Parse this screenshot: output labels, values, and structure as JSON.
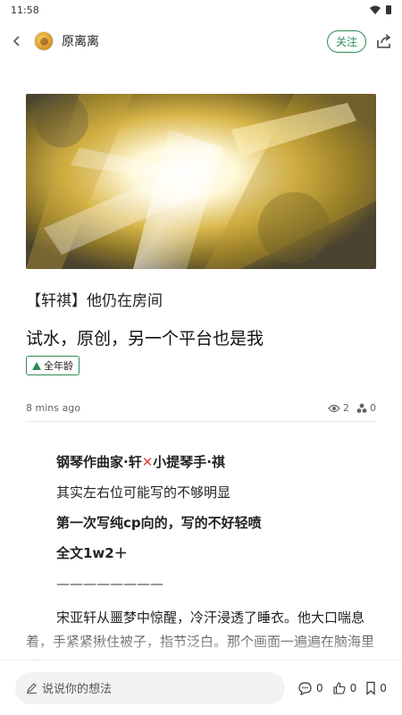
{
  "status": {
    "time": "11:58"
  },
  "header": {
    "author": "原离离",
    "follow_label": "关注"
  },
  "work": {
    "title": "【轩祺】他仍在房间",
    "summary": "试水，原创，另一个平台也是我",
    "rating": "全年龄",
    "time_ago": "8 mins ago",
    "views": "2",
    "kudos": "0"
  },
  "body": {
    "line1_a": "钢琴作曲家·轩",
    "line1_b": "小提琴手·祺",
    "line2": "其实左右位可能写的不够明显",
    "line3": "第一次写纯cp向的，写的不好轻喷",
    "line4": "全文1w2＋",
    "divider": "————————",
    "story": "宋亚轩从噩梦中惊醒，冷汗浸透了睡衣。他大口喘息着，手紧紧揪住被子，指节泛白。那个画面一遍遍在脑海里重播，宋亚轩猛得把自己埋进被窝，额头"
  },
  "footer": {
    "comment_placeholder": "说说你的想法",
    "comments": "0",
    "likes": "0",
    "bookmarks": "0"
  },
  "colors": {
    "accent": "#2e8b57"
  }
}
